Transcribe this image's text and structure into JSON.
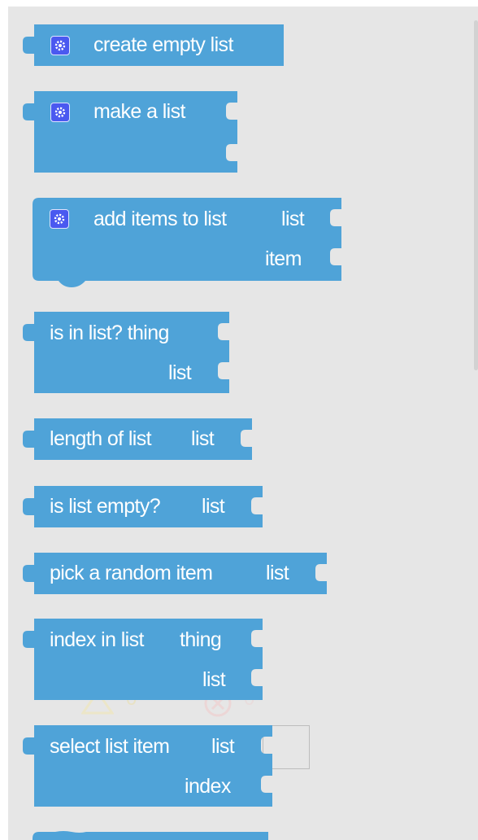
{
  "colors": {
    "block": "#4fa3d8",
    "flyout_bg": "#e6e6e6",
    "gear": "#4a59f0"
  },
  "blocks": [
    {
      "name": "create-empty-list",
      "has_gear": true,
      "labels": [
        "create empty list"
      ]
    },
    {
      "name": "make-a-list",
      "has_gear": true,
      "labels": [
        "make a list"
      ]
    },
    {
      "name": "add-items-to-list",
      "has_gear": true,
      "labels": [
        "add items to list",
        "list",
        "item"
      ]
    },
    {
      "name": "is-in-list",
      "labels": [
        "is in list? thing",
        "list"
      ]
    },
    {
      "name": "length-of-list",
      "labels": [
        "length of list",
        "list"
      ]
    },
    {
      "name": "is-list-empty",
      "labels": [
        "is list empty?",
        "list"
      ]
    },
    {
      "name": "pick-random-item",
      "labels": [
        "pick a random item",
        "list"
      ]
    },
    {
      "name": "index-in-list",
      "labels": [
        "index in list",
        "thing",
        "list"
      ]
    },
    {
      "name": "select-list-item",
      "labels": [
        "select list item",
        "list",
        "index"
      ]
    }
  ],
  "background_counts": {
    "warnings": "0",
    "errors": "0"
  },
  "icons": {
    "gear": "gear-icon",
    "warning": "warning-icon",
    "error": "error-icon"
  }
}
